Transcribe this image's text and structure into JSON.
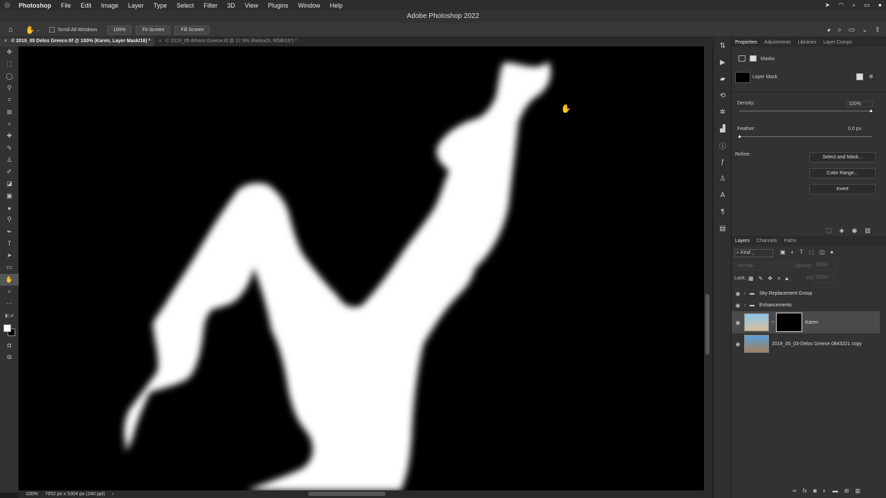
{
  "menubar": {
    "app": "Photoshop",
    "items": [
      "File",
      "Edit",
      "Image",
      "Layer",
      "Type",
      "Select",
      "Filter",
      "3D",
      "View",
      "Plugins",
      "Window",
      "Help"
    ]
  },
  "window": {
    "title": "Adobe Photoshop 2022"
  },
  "options": {
    "scroll_all": "Scroll All Windows",
    "zoom": "100%",
    "fit": "Fit Screen",
    "fill": "Fill Screen"
  },
  "tabs": [
    {
      "close": "×",
      "label": "© 2019_05 Delos Greece.tif @ 100% (Karen, Layer Mask/16) *"
    },
    {
      "close": "×",
      "label": "© 2019_05 Athens Greece.tif @ 17.9% (Retouch, RGB/16*) *"
    }
  ],
  "status": {
    "zoom": "100%",
    "info": "7952 px x 5304 px (240 ppi)",
    "arrow": "›"
  },
  "properties": {
    "tabs": [
      "Properties",
      "Adjustments",
      "Libraries",
      "Layer Comps"
    ],
    "section": "Masks",
    "mask_label": "Layer Mask",
    "density_label": "Density:",
    "density_value": "100%",
    "density_level": 1.0,
    "feather_label": "Feather:",
    "feather_value": "0.0 px",
    "feather_level": 0.0,
    "refine_label": "Refine:",
    "buttons": [
      "Select and Mask...",
      "Color Range...",
      "Invert"
    ]
  },
  "layers_panel": {
    "tabs": [
      "Layers",
      "Channels",
      "Paths"
    ],
    "kind": "Kind",
    "blend": "Normal",
    "opacity_label": "Opacity:",
    "opacity_value": "100%",
    "lock_label": "Lock:",
    "fill_label": "Fill:",
    "fill_value": "100%",
    "layers": [
      {
        "name": "Sky Replacement Group",
        "type": "group"
      },
      {
        "name": "Enhancements",
        "type": "group"
      },
      {
        "name": "Karen",
        "type": "masked"
      },
      {
        "name": "2019_05_03-Delos Greece 0843221 copy",
        "type": "image"
      }
    ]
  },
  "colors": {
    "accent": "#4a4a4a",
    "canvas_bg": "#000000",
    "mask_white": "#ffffff"
  }
}
